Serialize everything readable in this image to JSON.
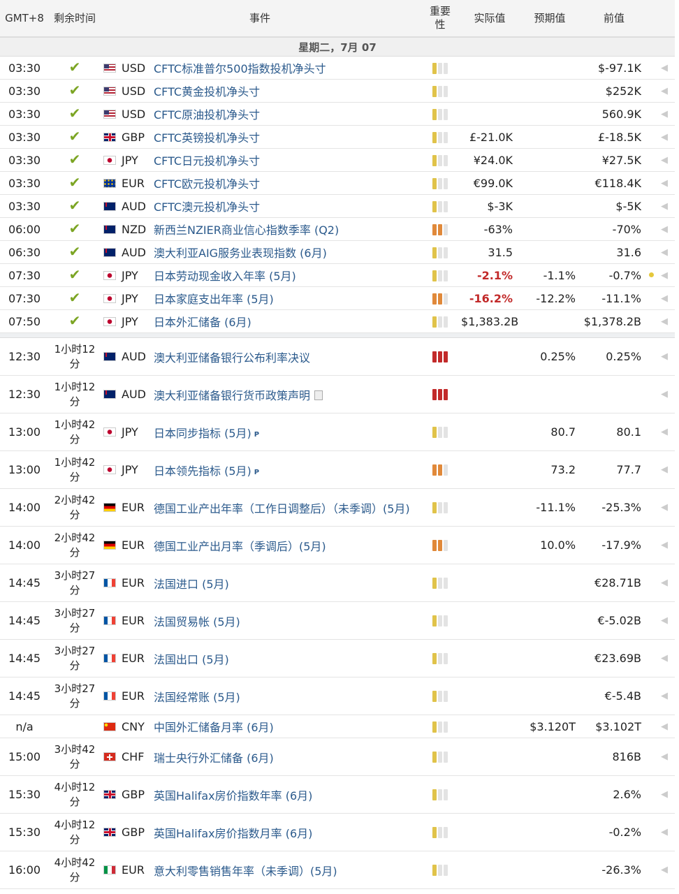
{
  "header": {
    "timezone": "GMT+8",
    "remaining": "剩余时间",
    "event": "事件",
    "importance": "重要性",
    "actual": "实际值",
    "forecast": "预期值",
    "previous": "前值"
  },
  "date_label": "星期二，7月 07",
  "colors": {
    "link": "#2b5a8c",
    "red": "#c22a2a",
    "check": "#7ca524",
    "low": "#e0c34a",
    "mid": "#e0893a",
    "high": "#c22a2a"
  },
  "rows": [
    {
      "time": "03:30",
      "left": "✔",
      "cur": "USD",
      "flag": "us",
      "event": "CFTC标准普尔500指数投机净头寸",
      "imp": 1,
      "actual": "",
      "forecast": "",
      "previous": "$-97.1K"
    },
    {
      "time": "03:30",
      "left": "✔",
      "cur": "USD",
      "flag": "us",
      "event": "CFTC黄金投机净头寸",
      "imp": 1,
      "actual": "",
      "forecast": "",
      "previous": "$252K"
    },
    {
      "time": "03:30",
      "left": "✔",
      "cur": "USD",
      "flag": "us",
      "event": "CFTC原油投机净头寸",
      "imp": 1,
      "actual": "",
      "forecast": "",
      "previous": "560.9K"
    },
    {
      "time": "03:30",
      "left": "✔",
      "cur": "GBP",
      "flag": "gb",
      "event": "CFTC英镑投机净头寸",
      "imp": 1,
      "actual": "£-21.0K",
      "forecast": "",
      "previous": "£-18.5K"
    },
    {
      "time": "03:30",
      "left": "✔",
      "cur": "JPY",
      "flag": "jp",
      "event": "CFTC日元投机净头寸",
      "imp": 1,
      "actual": "¥24.0K",
      "forecast": "",
      "previous": "¥27.5K"
    },
    {
      "time": "03:30",
      "left": "✔",
      "cur": "EUR",
      "flag": "eu",
      "event": "CFTC欧元投机净头寸",
      "imp": 1,
      "actual": "€99.0K",
      "forecast": "",
      "previous": "€118.4K"
    },
    {
      "time": "03:30",
      "left": "✔",
      "cur": "AUD",
      "flag": "au",
      "event": "CFTC澳元投机净头寸",
      "imp": 1,
      "actual": "$-3K",
      "forecast": "",
      "previous": "$-5K"
    },
    {
      "time": "06:00",
      "left": "✔",
      "cur": "NZD",
      "flag": "au",
      "event": "新西兰NZIER商业信心指数季率 (Q2)",
      "imp": 2,
      "actual": "-63%",
      "forecast": "",
      "previous": "-70%"
    },
    {
      "time": "06:30",
      "left": "✔",
      "cur": "AUD",
      "flag": "au",
      "event": "澳大利亚AIG服务业表现指数 (6月)",
      "imp": 1,
      "actual": "31.5",
      "forecast": "",
      "previous": "31.6"
    },
    {
      "time": "07:30",
      "left": "✔",
      "cur": "JPY",
      "flag": "jp",
      "event": "日本劳动现金收入年率 (5月)",
      "imp": 1,
      "actual": "-2.1%",
      "actual_red": true,
      "forecast": "-1.1%",
      "previous": "-0.7%",
      "dot": true
    },
    {
      "time": "07:30",
      "left": "✔",
      "cur": "JPY",
      "flag": "jp",
      "event": "日本家庭支出年率 (5月)",
      "imp": 2,
      "actual": "-16.2%",
      "actual_red": true,
      "forecast": "-12.2%",
      "previous": "-11.1%"
    },
    {
      "time": "07:50",
      "left": "✔",
      "cur": "JPY",
      "flag": "jp",
      "event": "日本外汇储备 (6月)",
      "imp": 1,
      "actual": "$1,383.2B",
      "forecast": "",
      "previous": "$1,378.2B"
    },
    {
      "sep": true
    },
    {
      "time": "12:30",
      "left": "1小时12\n分",
      "cur": "AUD",
      "flag": "au",
      "event": "澳大利亚储备银行公布利率决议",
      "imp": 3,
      "actual": "",
      "forecast": "0.25%",
      "previous": "0.25%"
    },
    {
      "time": "12:30",
      "left": "1小时12\n分",
      "cur": "AUD",
      "flag": "au",
      "event": "澳大利亚储备银行货币政策声明",
      "doc": true,
      "imp": 3,
      "actual": "",
      "forecast": "",
      "previous": ""
    },
    {
      "time": "13:00",
      "left": "1小时42\n分",
      "cur": "JPY",
      "flag": "jp",
      "event": "日本同步指标 (5月)",
      "p": true,
      "imp": 1,
      "actual": "",
      "forecast": "80.7",
      "previous": "80.1"
    },
    {
      "time": "13:00",
      "left": "1小时42\n分",
      "cur": "JPY",
      "flag": "jp",
      "event": "日本领先指标 (5月)",
      "p": true,
      "imp": 2,
      "actual": "",
      "forecast": "73.2",
      "previous": "77.7"
    },
    {
      "time": "14:00",
      "left": "2小时42\n分",
      "cur": "EUR",
      "flag": "de",
      "event": "德国工业产出年率（工作日调整后）（未季调）(5月)",
      "imp": 1,
      "actual": "",
      "forecast": "-11.1%",
      "previous": "-25.3%"
    },
    {
      "time": "14:00",
      "left": "2小时42\n分",
      "cur": "EUR",
      "flag": "de",
      "event": "德国工业产出月率（季调后）(5月)",
      "imp": 2,
      "actual": "",
      "forecast": "10.0%",
      "previous": "-17.9%"
    },
    {
      "time": "14:45",
      "left": "3小时27\n分",
      "cur": "EUR",
      "flag": "fr",
      "event": "法国进口 (5月)",
      "imp": 1,
      "actual": "",
      "forecast": "",
      "previous": "€28.71B"
    },
    {
      "time": "14:45",
      "left": "3小时27\n分",
      "cur": "EUR",
      "flag": "fr",
      "event": "法国贸易帐 (5月)",
      "imp": 1,
      "actual": "",
      "forecast": "",
      "previous": "€-5.02B"
    },
    {
      "time": "14:45",
      "left": "3小时27\n分",
      "cur": "EUR",
      "flag": "fr",
      "event": "法国出口 (5月)",
      "imp": 1,
      "actual": "",
      "forecast": "",
      "previous": "€23.69B"
    },
    {
      "time": "14:45",
      "left": "3小时27\n分",
      "cur": "EUR",
      "flag": "fr",
      "event": "法国经常账 (5月)",
      "imp": 1,
      "actual": "",
      "forecast": "",
      "previous": "€-5.4B"
    },
    {
      "time": "n/a",
      "left": "",
      "cur": "CNY",
      "flag": "cn",
      "event": "中国外汇储备月率 (6月)",
      "imp": 1,
      "actual": "",
      "forecast": "$3.120T",
      "previous": "$3.102T",
      "na": true
    },
    {
      "time": "15:00",
      "left": "3小时42\n分",
      "cur": "CHF",
      "flag": "ch",
      "event": "瑞士央行外汇储备 (6月)",
      "imp": 1,
      "actual": "",
      "forecast": "",
      "previous": "816B"
    },
    {
      "time": "15:30",
      "left": "4小时12\n分",
      "cur": "GBP",
      "flag": "gb",
      "event": "英国Halifax房价指数年率 (6月)",
      "imp": 1,
      "actual": "",
      "forecast": "",
      "previous": "2.6%"
    },
    {
      "time": "15:30",
      "left": "4小时12\n分",
      "cur": "GBP",
      "flag": "gb",
      "event": "英国Halifax房价指数月率 (6月)",
      "imp": 1,
      "actual": "",
      "forecast": "",
      "previous": "-0.2%"
    },
    {
      "time": "16:00",
      "left": "4小时42\n分",
      "cur": "EUR",
      "flag": "it",
      "event": "意大利零售销售年率（未季调）(5月)",
      "imp": 1,
      "actual": "",
      "forecast": "",
      "previous": "-26.3%"
    }
  ]
}
